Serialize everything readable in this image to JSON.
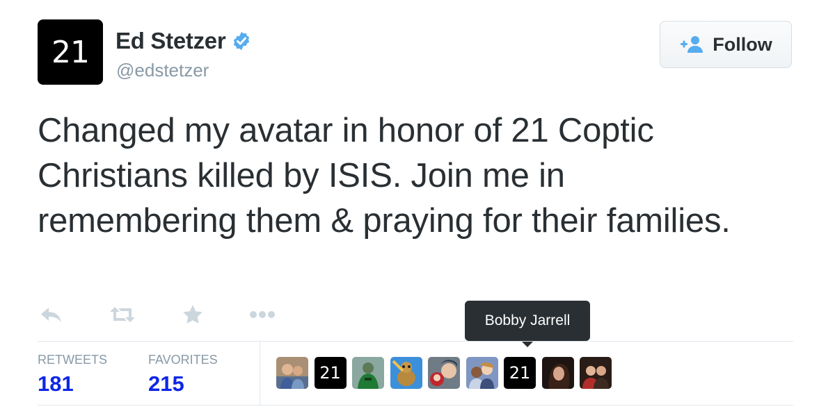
{
  "tweet": {
    "author": {
      "avatar_text": "21",
      "name": "Ed Stetzer",
      "handle": "@edstetzer",
      "verified": true
    },
    "follow_button": {
      "label": "Follow",
      "icon": "add-user-icon"
    },
    "text": "Changed my avatar in honor of 21 Coptic Christians killed by ISIS. Join me in remembering them & praying for their families.",
    "actions": [
      {
        "name": "reply",
        "icon": "reply-icon"
      },
      {
        "name": "retweet",
        "icon": "retweet-icon"
      },
      {
        "name": "favorite",
        "icon": "star-icon"
      },
      {
        "name": "more",
        "icon": "more-icon"
      }
    ],
    "stats": {
      "retweets_label": "RETWEETS",
      "retweets": "181",
      "favorites_label": "FAVORITES",
      "favorites": "215"
    },
    "tooltip": "Bobby Jarrell",
    "favoriter_avatars": [
      {
        "kind": "photo"
      },
      {
        "kind": "text",
        "text": "21"
      },
      {
        "kind": "photo"
      },
      {
        "kind": "photo"
      },
      {
        "kind": "photo"
      },
      {
        "kind": "photo"
      },
      {
        "kind": "text",
        "text": "21"
      },
      {
        "kind": "photo"
      },
      {
        "kind": "photo"
      }
    ]
  },
  "colors": {
    "name": "#292f33",
    "muted": "#8899a6",
    "stat_value": "#0f27e6",
    "verified": "#55acee",
    "action_icon": "#ccd6dd",
    "follow_icon": "#55acee"
  }
}
